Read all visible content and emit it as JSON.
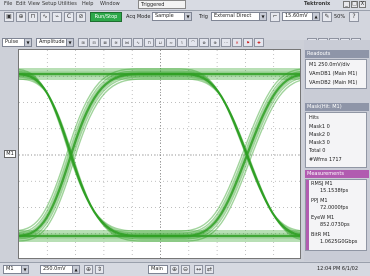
{
  "menubar": {
    "items": [
      "File",
      "Edit",
      "View",
      "Setup",
      "Utilities",
      "Help",
      "Window"
    ],
    "status": "Triggered",
    "brand": "Tektronix",
    "controls": [
      "_",
      "□",
      "X"
    ]
  },
  "toolbar": {
    "run_stop_label": "Run/Stop",
    "acq_mode_label": "Acq Mode",
    "acq_mode_value": "Sample",
    "trig_label": "Trig",
    "trig_value": "External Direct",
    "trig_level": "15.60mV",
    "zoom_value": "50%",
    "type_value": "Pulse",
    "amp_value": "Amplitude"
  },
  "measurement_panel": {
    "header": "Readouts",
    "rows": [
      "M1 250.0mV/div",
      "VAmDB1 (Main M1)",
      "VAmDB2 (Main M1)"
    ]
  },
  "mask_panel": {
    "header": "Mask(Hit: M1)",
    "rows": [
      "Hits",
      "Mask1  0",
      "Mask2  0",
      "Mask3  0",
      "Total  0",
      "#Wfms  1717"
    ]
  },
  "readout_panel": {
    "header": "Measurements",
    "entries": [
      {
        "label": "RMSJ  M1",
        "value": "15.1538fps"
      },
      {
        "label": "PPJ   M1",
        "value": "72.0000fps"
      },
      {
        "label": "EyeW  M1",
        "value": "852.0730ps"
      },
      {
        "label": "BitR  M1",
        "value": "1.0625G0Gbps"
      }
    ]
  },
  "markers": {
    "channel": "M1"
  },
  "bottom": {
    "channel": "M1",
    "scale": "250.0mV",
    "view": "Main",
    "clock": "12:04 PM 6/1/02"
  },
  "colors": {
    "waveform": "#2f9f23",
    "runstop": "#2da84a",
    "accent": "#b15bb0"
  }
}
